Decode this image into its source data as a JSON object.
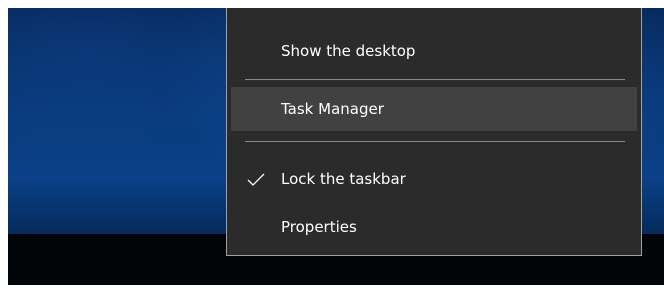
{
  "context_menu": {
    "items": [
      {
        "label": "Show the desktop",
        "checked": false,
        "highlighted": false
      },
      {
        "label": "Task Manager",
        "checked": false,
        "highlighted": true
      },
      {
        "label": "Lock the taskbar",
        "checked": true,
        "highlighted": false
      },
      {
        "label": "Properties",
        "checked": false,
        "highlighted": false
      }
    ]
  },
  "colors": {
    "menu_background": "#2b2b2b",
    "menu_border": "#a0a0a0",
    "menu_highlight": "#414141",
    "menu_text": "#ffffff",
    "separator": "#8b8b8b",
    "desktop_blue": "#083a7c",
    "taskbar": "#020508"
  },
  "icons": {
    "lock_taskbar_check": "checkmark-icon"
  }
}
